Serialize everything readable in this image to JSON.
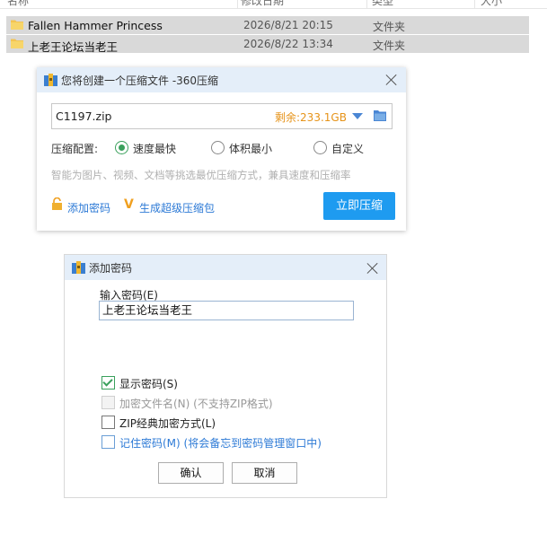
{
  "explorer": {
    "columns": {
      "name": "名称",
      "date": "修改日期",
      "type": "类型",
      "size": "大小"
    },
    "rows": [
      {
        "name": "Fallen Hammer Princess",
        "date": "2026/8/21 20:15",
        "type": "文件夹"
      },
      {
        "name": "上老王论坛当老王",
        "date": "2026/8/22 13:34",
        "type": "文件夹"
      }
    ]
  },
  "compress_dialog": {
    "title": "您将创建一个压缩文件 -360压缩",
    "filename": "C1197.zip",
    "remaining": "剩余:233.1GB",
    "config_label": "压缩配置:",
    "options": [
      "速度最快",
      "体积最小",
      "自定义"
    ],
    "selected_option": "速度最快",
    "hint": "智能为图片、视频、文档等挑选最优压缩方式，兼具速度和压缩率",
    "add_password": "添加密码",
    "super_compress": "生成超级压缩包",
    "compress_button": "立即压缩"
  },
  "password_dialog": {
    "title": "添加密码",
    "input_label": "输入密码(E)",
    "password_value": "上老王论坛当老王",
    "checkboxes": [
      {
        "label": "显示密码(S)",
        "checked": true,
        "enabled": true
      },
      {
        "label": "加密文件名(N) (不支持ZIP格式)",
        "checked": false,
        "enabled": false
      },
      {
        "label": "ZIP经典加密方式(L)",
        "checked": false,
        "enabled": true
      },
      {
        "label": "记住密码(M) (将会备忘到密码管理窗口中)",
        "checked": false,
        "enabled": true
      }
    ],
    "ok_button": "确认",
    "cancel_button": "取消"
  },
  "colors": {
    "title_bar": "#e4eef9",
    "accent_blue": "#1e9bf0",
    "link_blue": "#2d7ad6",
    "remaining_orange": "#e69319",
    "radio_green": "#3aa05c",
    "selection_gray": "#d9d9d9"
  }
}
